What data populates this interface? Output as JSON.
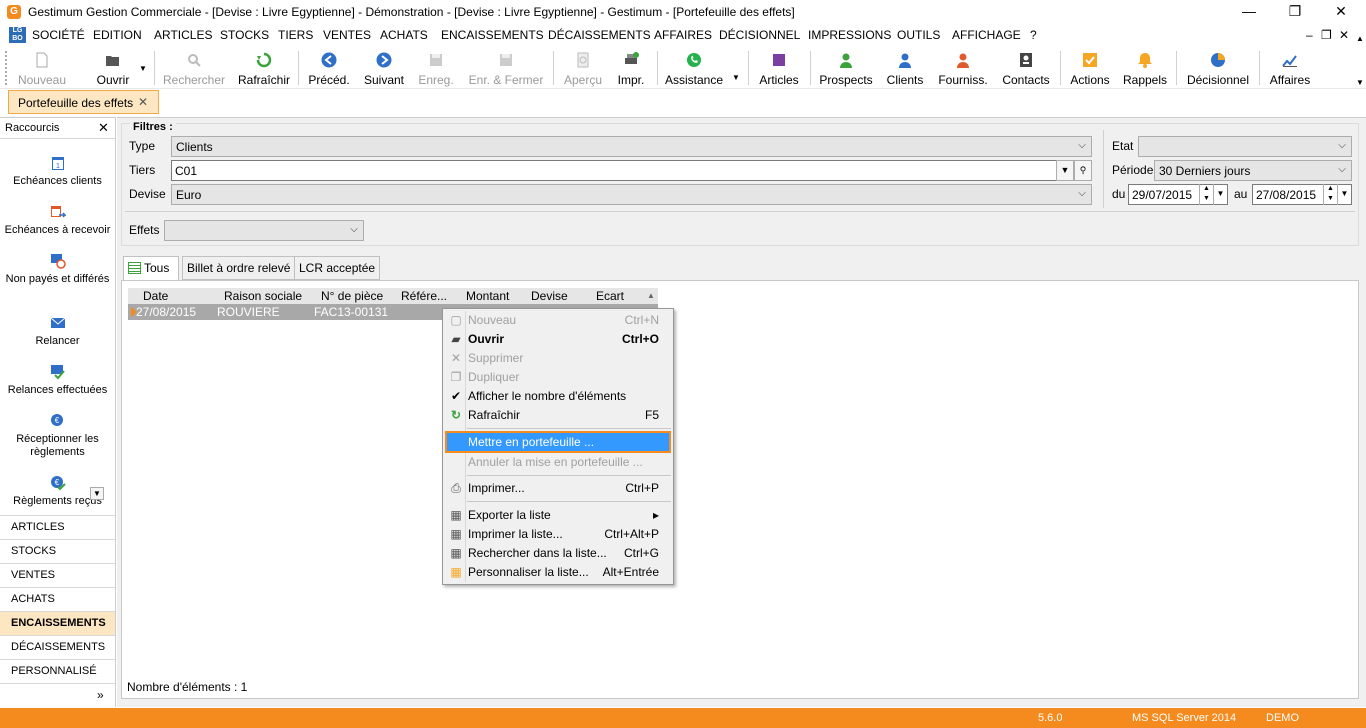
{
  "window": {
    "title": "Gestimum Gestion Commerciale - [Devise : Livre Egyptienne] - Démonstration - [Devise : Livre Egyptienne] - Gestimum - [Portefeuille des effets]",
    "app_icon": "G",
    "minimize": "—",
    "restore": "❐",
    "close": "✕"
  },
  "menu": {
    "logo": "LG BO",
    "items": [
      "SOCIÉTÉ",
      "EDITION",
      "ARTICLES",
      "STOCKS",
      "TIERS",
      "VENTES",
      "ACHATS",
      "ENCAISSEMENTS",
      "DÉCAISSEMENTS",
      "AFFAIRES",
      "DÉCISIONNEL",
      "IMPRESSIONS",
      "OUTILS",
      "AFFICHAGE",
      "?"
    ],
    "mdi_min": "–",
    "mdi_restore": "❐",
    "mdi_close": "✕"
  },
  "toolbar": {
    "nouveau": "Nouveau",
    "ouvrir": "Ouvrir",
    "rechercher": "Rechercher",
    "rafraichir": "Rafraîchir",
    "preced": "Précéd.",
    "suivant": "Suivant",
    "enreg": "Enreg.",
    "enr_fermer": "Enr. & Fermer",
    "apercu": "Aperçu",
    "impr": "Impr.",
    "assistance": "Assistance",
    "articles": "Articles",
    "prospects": "Prospects",
    "clients": "Clients",
    "fourniss": "Fourniss.",
    "contacts": "Contacts",
    "actions": "Actions",
    "rappels": "Rappels",
    "decisionnel": "Décisionnel",
    "affaires": "Affaires"
  },
  "doc_tab": {
    "label": "Portefeuille des effets",
    "close": "✕"
  },
  "left_panel": {
    "title": "Raccourcis",
    "close": "✕",
    "shortcuts": [
      "Echéances clients",
      "Echéances à recevoir",
      "Non payés et différés",
      "Relancer",
      "Relances effectuées",
      "Réceptionner les règlements",
      "Règlements reçus"
    ],
    "nav": [
      "ARTICLES",
      "STOCKS",
      "VENTES",
      "ACHATS",
      "ENCAISSEMENTS",
      "DÉCAISSEMENTS",
      "PERSONNALISÉ"
    ],
    "active_nav": "ENCAISSEMENTS",
    "more": "»"
  },
  "filters": {
    "title": "Filtres :",
    "type_label": "Type",
    "type_value": "Clients",
    "tiers_label": "Tiers",
    "tiers_value": "C01",
    "devise_label": "Devise",
    "devise_value": "Euro",
    "etat_label": "Etat",
    "etat_value": "",
    "periode_label": "Période",
    "periode_value": "30 Derniers jours",
    "du_label": "du",
    "du_value": "29/07/2015",
    "au_label": "au",
    "au_value": "27/08/2015",
    "effets_label": "Effets",
    "effets_value": ""
  },
  "list_tabs": [
    "Tous",
    "Billet à ordre relevé",
    "LCR acceptée"
  ],
  "grid": {
    "columns": [
      "Date",
      "Raison sociale",
      "N° de pièce",
      "Référe...",
      "Montant",
      "Devise",
      "Ecart"
    ],
    "rows": [
      {
        "date": "27/08/2015",
        "raison": "ROUVIERE",
        "piece": "FAC13-00131"
      }
    ]
  },
  "count_label": "Nombre d'éléments : 1",
  "context_menu": [
    {
      "label": "Nouveau",
      "shortcut": "Ctrl+N",
      "state": "disabled"
    },
    {
      "label": "Ouvrir",
      "shortcut": "Ctrl+O",
      "state": "bold"
    },
    {
      "label": "Supprimer",
      "shortcut": "",
      "state": "disabled"
    },
    {
      "label": "Dupliquer",
      "shortcut": "",
      "state": "disabled"
    },
    {
      "label": "Afficher le nombre d'éléments",
      "shortcut": "",
      "state": "checked"
    },
    {
      "label": "Rafraîchir",
      "shortcut": "F5",
      "state": "normal"
    },
    {
      "label": "Mettre en portefeuille ...",
      "shortcut": "",
      "state": "highlighted"
    },
    {
      "label": "Annuler la mise en portefeuille ...",
      "shortcut": "",
      "state": "disabled"
    },
    {
      "label": "Imprimer...",
      "shortcut": "Ctrl+P",
      "state": "normal"
    },
    {
      "label": "Exporter la liste",
      "shortcut": "▸",
      "state": "normal"
    },
    {
      "label": "Imprimer la liste...",
      "shortcut": "Ctrl+Alt+P",
      "state": "normal"
    },
    {
      "label": "Rechercher dans la liste...",
      "shortcut": "Ctrl+G",
      "state": "normal"
    },
    {
      "label": "Personnaliser la liste...",
      "shortcut": "Alt+Entrée",
      "state": "normal"
    }
  ],
  "status": {
    "version": "5.6.0",
    "server": "MS SQL Server 2014",
    "mode": "DEMO"
  },
  "colors": {
    "accent": "#f58a1f",
    "highlight": "#3399ff",
    "tab_active": "#fde6c2"
  }
}
